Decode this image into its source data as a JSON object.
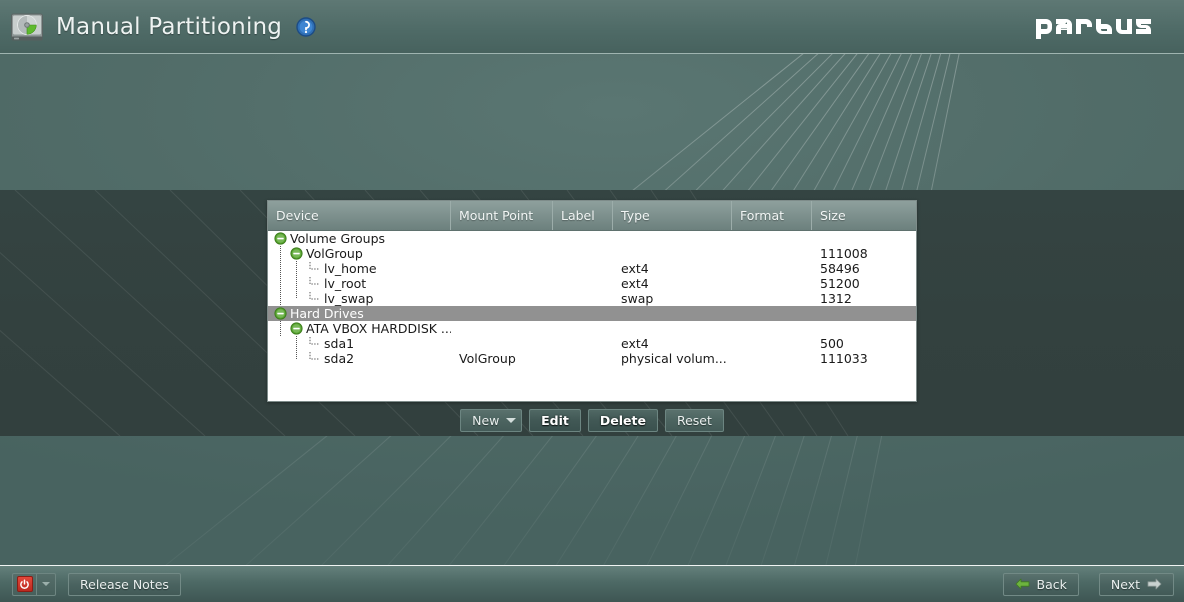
{
  "header": {
    "title": "Manual Partitioning",
    "disk_icon": "hard-disk-icon",
    "help_icon": "help-circle-icon",
    "brand": "pardus",
    "title_color": "#eef3f2",
    "bar_color": "#4f6b67"
  },
  "table": {
    "columns": [
      {
        "key": "device",
        "label": "Device"
      },
      {
        "key": "mount",
        "label": "Mount Point"
      },
      {
        "key": "label",
        "label": "Label"
      },
      {
        "key": "type",
        "label": "Type"
      },
      {
        "key": "format",
        "label": "Format"
      },
      {
        "key": "size",
        "label": "Size"
      }
    ],
    "rows": [
      {
        "depth": 0,
        "expander": "collapse-icon",
        "device": "Volume Groups",
        "mount": "",
        "label": "",
        "type": "",
        "format": "",
        "size": "",
        "selected": false
      },
      {
        "depth": 1,
        "expander": "collapse-icon",
        "device": "VolGroup",
        "mount": "",
        "label": "",
        "type": "",
        "format": "",
        "size": "111008",
        "selected": false
      },
      {
        "depth": 2,
        "expander": "leaf-branch-icon",
        "device": "lv_home",
        "mount": "",
        "label": "",
        "type": "ext4",
        "format": "",
        "size": "58496",
        "selected": false
      },
      {
        "depth": 2,
        "expander": "leaf-branch-icon",
        "device": "lv_root",
        "mount": "",
        "label": "",
        "type": "ext4",
        "format": "",
        "size": "51200",
        "selected": false
      },
      {
        "depth": 2,
        "expander": "leaf-branch-icon",
        "device": "lv_swap",
        "mount": "",
        "label": "",
        "type": "swap",
        "format": "",
        "size": "1312",
        "selected": false
      },
      {
        "depth": 0,
        "expander": "collapse-icon",
        "device": "Hard Drives",
        "mount": "",
        "label": "",
        "type": "",
        "format": "",
        "size": "",
        "selected": true
      },
      {
        "depth": 1,
        "expander": "collapse-icon",
        "device": "ATA VBOX HARDDISK ...",
        "mount": "",
        "label": "",
        "type": "",
        "format": "",
        "size": "",
        "selected": false
      },
      {
        "depth": 2,
        "expander": "leaf-branch-icon",
        "device": "sda1",
        "mount": "",
        "label": "",
        "type": "ext4",
        "format": "",
        "size": "500",
        "selected": false
      },
      {
        "depth": 2,
        "expander": "leaf-branch-icon",
        "device": "sda2",
        "mount": "VolGroup",
        "label": "",
        "type": "physical volum...",
        "format": "",
        "size": "111033",
        "selected": false
      }
    ],
    "selected_row_color": "#919191",
    "expander_color": "#5aa832"
  },
  "toolbar": {
    "new_label": "New",
    "new_has_dropdown": true,
    "edit_label": "Edit",
    "delete_label": "Delete",
    "reset_label": "Reset"
  },
  "footer": {
    "power_icon": "power-icon",
    "power_dropdown_icon": "chevron-down-icon",
    "release_notes_label": "Release Notes",
    "back_label": "Back",
    "back_icon": "arrow-left-icon",
    "next_label": "Next",
    "next_icon": "arrow-right-icon",
    "back_arrow_color": "#6db33f",
    "next_arrow_color": "#c9d2d0"
  }
}
